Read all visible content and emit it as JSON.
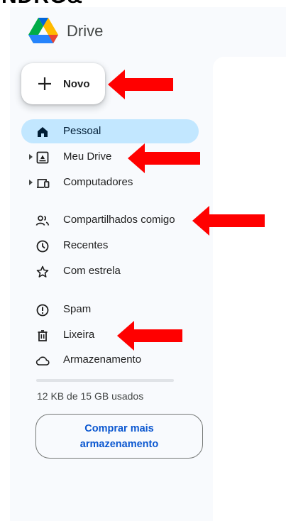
{
  "app": {
    "title": "Drive"
  },
  "new_button": {
    "label": "Novo"
  },
  "nav": {
    "pessoal": "Pessoal",
    "meu_drive": "Meu Drive",
    "computadores": "Computadores",
    "compartilhados": "Compartilhados comigo",
    "recentes": "Recentes",
    "com_estrela": "Com estrela",
    "spam": "Spam",
    "lixeira": "Lixeira",
    "armazenamento": "Armazenamento"
  },
  "storage": {
    "used_text": "12 KB de 15 GB usados",
    "used_fraction": 1e-06,
    "buy_label": "Comprar mais armazenamento"
  },
  "colors": {
    "active_bg": "#c2e7ff",
    "accent_blue": "#0b57d0",
    "annotation_arrow": "#ff0000"
  },
  "icons": [
    "plus-icon",
    "home-icon",
    "drive-icon",
    "computer-icon",
    "people-icon",
    "clock-icon",
    "star-icon",
    "spam-icon",
    "trash-icon",
    "cloud-icon"
  ]
}
